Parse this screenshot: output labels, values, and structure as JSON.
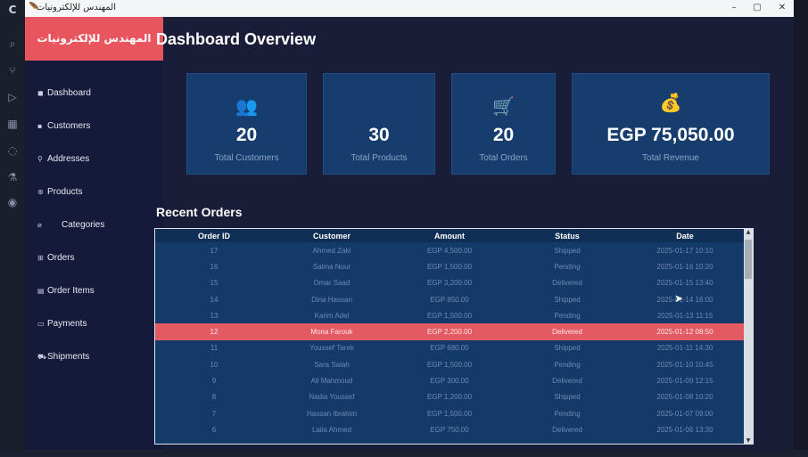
{
  "window": {
    "title": "المهندس للإلكترونيات"
  },
  "brand": {
    "name": "المهندس للإلكترونيات"
  },
  "sidebar": {
    "items": [
      {
        "label": "Dashboard",
        "icon": "dashboard-icon"
      },
      {
        "label": "Customers",
        "icon": "customers-icon"
      },
      {
        "label": "Addresses",
        "icon": "address-pin-icon"
      },
      {
        "label": "Products",
        "icon": "products-icon"
      },
      {
        "label": "Categories",
        "icon": "tag-icon"
      },
      {
        "label": "Orders",
        "icon": "cart-icon"
      },
      {
        "label": "Order Items",
        "icon": "list-icon"
      },
      {
        "label": "Payments",
        "icon": "payment-card-icon"
      },
      {
        "label": "Shipments",
        "icon": "truck-icon"
      }
    ]
  },
  "main": {
    "title": "Dashboard Overview",
    "stats": [
      {
        "value": "20",
        "label": "Total Customers",
        "icon": "users-icon",
        "color": "#f05a5f"
      },
      {
        "value": "30",
        "label": "Total Products",
        "icon": "",
        "color": ""
      },
      {
        "value": "20",
        "label": "Total Orders",
        "icon": "shopping-cart-icon",
        "color": "#f0a830"
      },
      {
        "value": "EGP 75,050.00",
        "label": "Total Revenue",
        "icon": "money-bag-icon",
        "color": "#3ec98a"
      }
    ],
    "recent_orders_title": "Recent Orders",
    "table": {
      "columns": [
        "Order ID",
        "Customer",
        "Amount",
        "Status",
        "Date"
      ],
      "rows": [
        [
          "17",
          "Ahmed Zaki",
          "EGP 4,500.00",
          "Shipped",
          "2025-01-17 10:10"
        ],
        [
          "16",
          "Salma Nour",
          "EGP 1,500.00",
          "Pending",
          "2025-01-16 10:20"
        ],
        [
          "15",
          "Omar Saad",
          "EGP 3,200.00",
          "Delivered",
          "2025-01-15 13:40"
        ],
        [
          "14",
          "Dina Hassan",
          "EGP 850.00",
          "Shipped",
          "2025-01-14 16:00"
        ],
        [
          "13",
          "Karim Adel",
          "EGP 1,500.00",
          "Pending",
          "2025-01-13 11:15"
        ],
        [
          "12",
          "Mona Farouk",
          "EGP 2,200.00",
          "Delivered",
          "2025-01-12 08:50"
        ],
        [
          "11",
          "Youssef Tarek",
          "EGP 680.00",
          "Shipped",
          "2025-01-11 14:30"
        ],
        [
          "10",
          "Sara Salah",
          "EGP 1,500.00",
          "Pending",
          "2025-01-10 10:45"
        ],
        [
          "9",
          "Ali Mahmoud",
          "EGP 300.00",
          "Delivered",
          "2025-01-09 12:15"
        ],
        [
          "8",
          "Nadia Youssef",
          "EGP 1,200.00",
          "Shipped",
          "2025-01-08 10:20"
        ],
        [
          "7",
          "Hassan Ibrahim",
          "EGP 1,500.00",
          "Pending",
          "2025-01-07 09:00"
        ],
        [
          "6",
          "Laila Ahmed",
          "EGP 750.00",
          "Delivered",
          "2025-01-06 13:30"
        ]
      ],
      "selected_row": 5
    }
  }
}
